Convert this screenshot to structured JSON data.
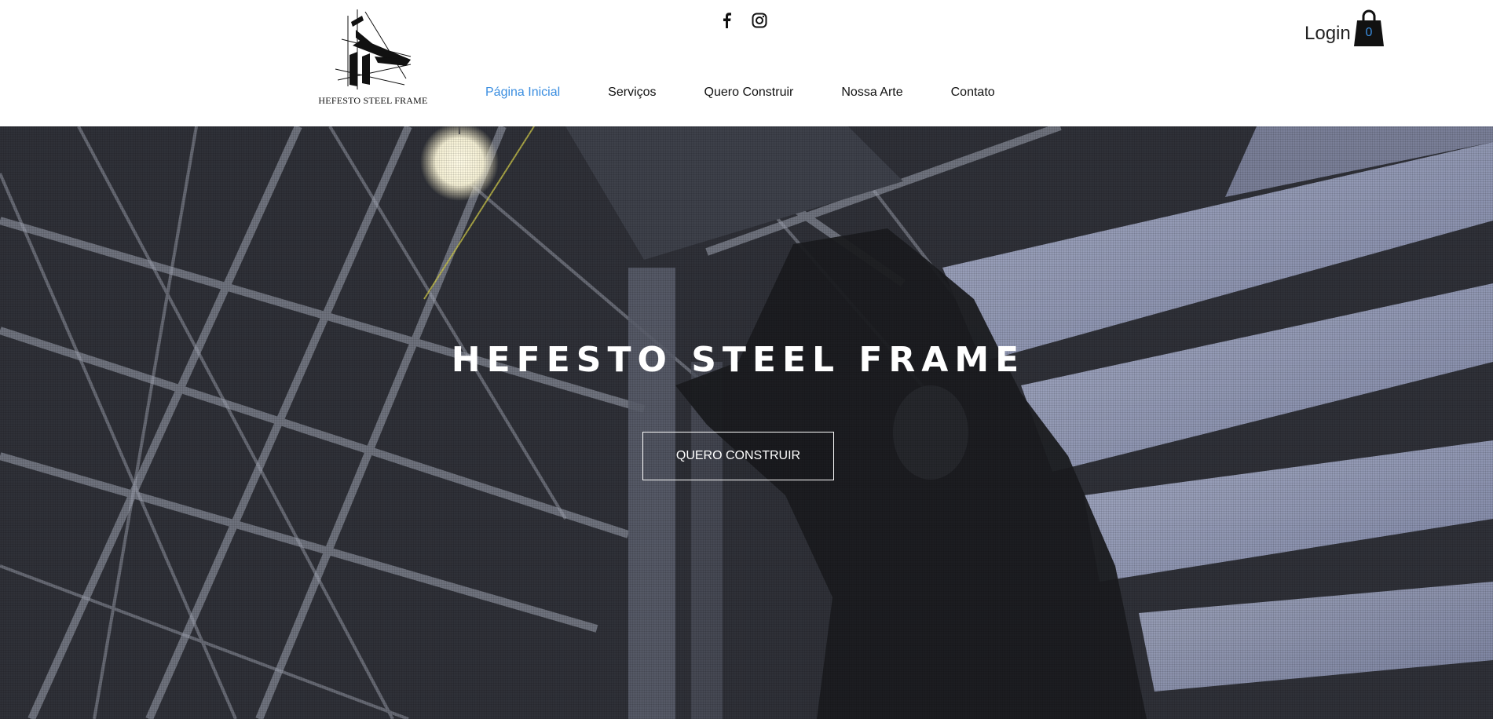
{
  "brand": {
    "name": "HEFESTO STEEL FRAME"
  },
  "social": [
    {
      "icon": "facebook-icon"
    },
    {
      "icon": "instagram-icon"
    }
  ],
  "nav": {
    "items": [
      {
        "label": "Página Inicial",
        "active": true
      },
      {
        "label": "Serviços",
        "active": false
      },
      {
        "label": "Quero Construir",
        "active": false
      },
      {
        "label": "Nossa Arte",
        "active": false
      },
      {
        "label": "Contato",
        "active": false
      }
    ]
  },
  "account": {
    "login_label": "Login"
  },
  "cart": {
    "count": "0"
  },
  "hero": {
    "title": "HEFESTO STEEL FRAME",
    "cta_label": "QUERO CONSTRUIR"
  },
  "colors": {
    "accent": "#3b8ee0",
    "text": "#111111",
    "hero_text": "#ffffff"
  }
}
